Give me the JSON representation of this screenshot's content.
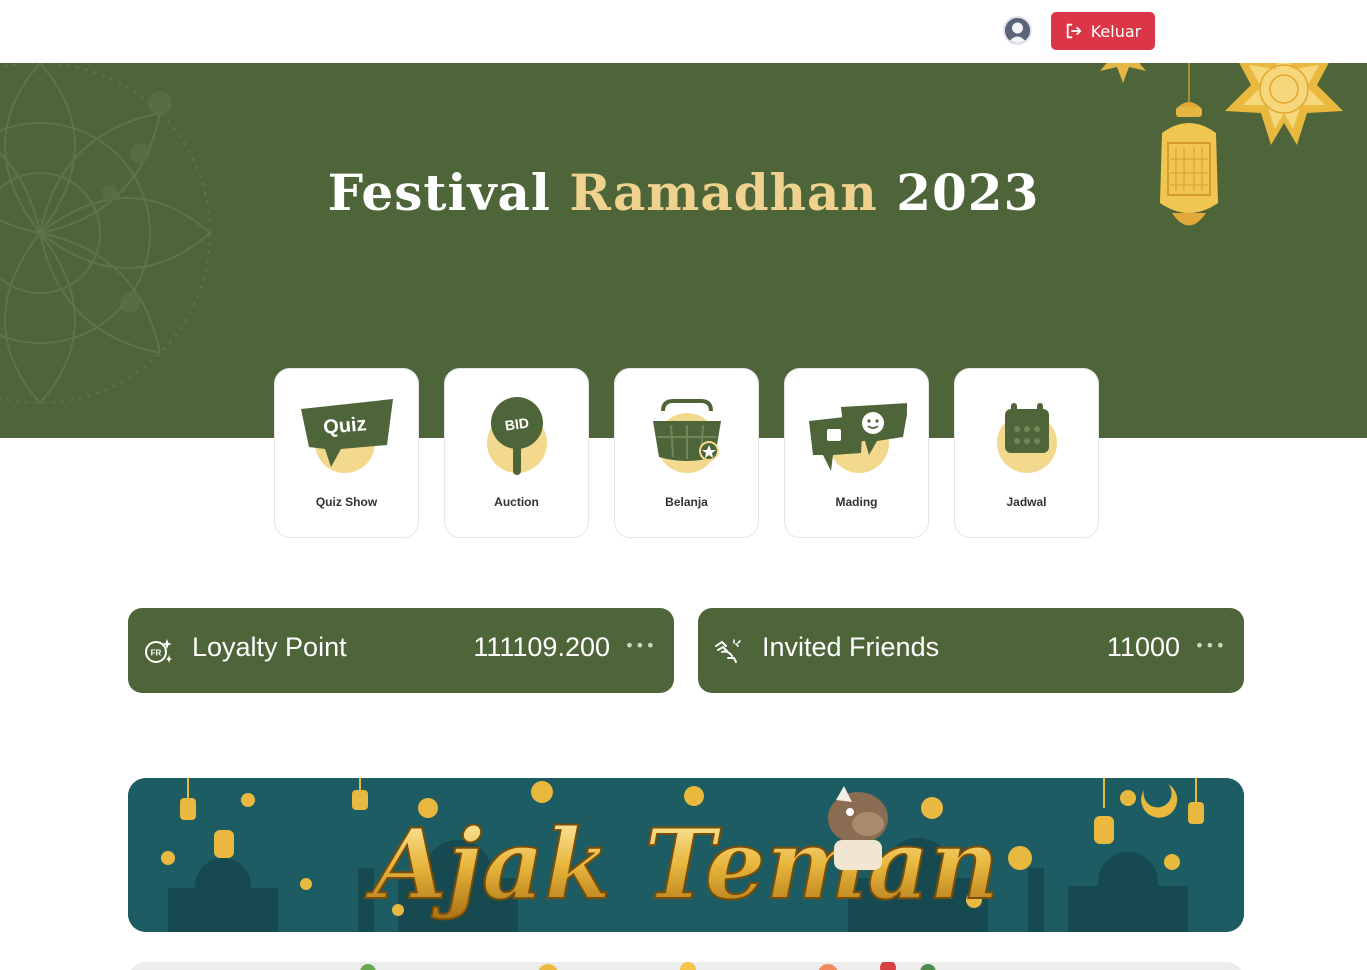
{
  "navbar": {
    "avatar_icon": "user-avatar-icon",
    "logout_label": "Keluar",
    "logout_icon": "logout-icon",
    "logout_color": "#dc3545"
  },
  "hero": {
    "title_part1": "Festival",
    "title_part2": "Ramadhan",
    "title_part3": "2023",
    "background_color": "#4e6539",
    "accent_color": "#efd28e"
  },
  "menu": {
    "items": [
      {
        "label": "Quiz Show",
        "icon": "quiz-icon",
        "icon_text": "Quiz"
      },
      {
        "label": "Auction",
        "icon": "auction-paddle-icon",
        "icon_text": "BID"
      },
      {
        "label": "Belanja",
        "icon": "shopping-basket-icon"
      },
      {
        "label": "Mading",
        "icon": "message-board-icon"
      },
      {
        "label": "Jadwal",
        "icon": "calendar-icon"
      }
    ]
  },
  "stats": {
    "loyalty": {
      "label": "Loyalty Point",
      "value": "111109.200",
      "icon": "loyalty-point-icon",
      "icon_text": "FR",
      "more": "•••"
    },
    "friends": {
      "label": "Invited Friends",
      "value": "11000",
      "icon": "invite-friends-icon",
      "more": "•••"
    }
  },
  "banner": {
    "title": "Ajak Teman",
    "background_color": "#1c5c62"
  }
}
